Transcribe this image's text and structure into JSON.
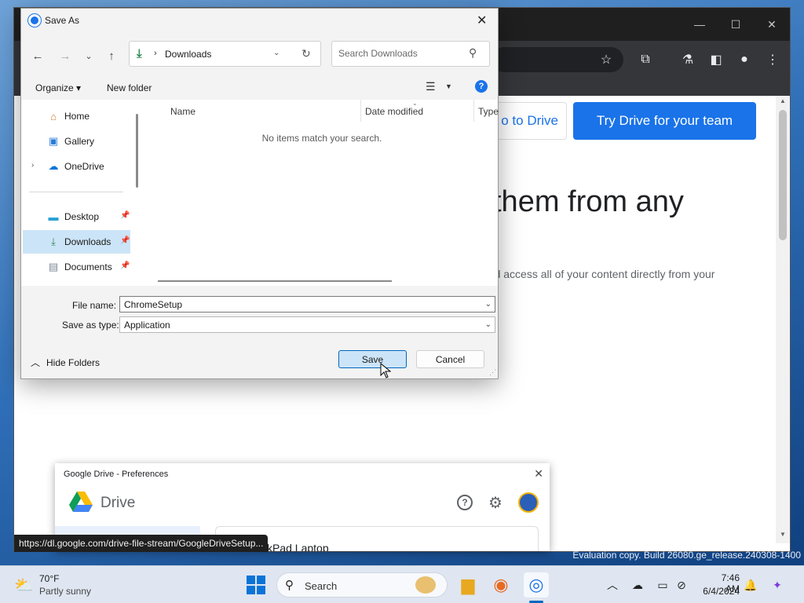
{
  "save_dialog": {
    "title": "Save As",
    "address": {
      "folder": "Downloads"
    },
    "search": {
      "placeholder": "Search Downloads"
    },
    "command_bar": {
      "organize_label": "Organize",
      "new_folder_label": "New folder"
    },
    "nav_items": [
      {
        "label": "Home",
        "icon": "home-icon"
      },
      {
        "label": "Gallery",
        "icon": "gallery-icon"
      },
      {
        "label": "OneDrive",
        "icon": "onedrive-icon"
      },
      {
        "label": "Desktop",
        "icon": "desktop-icon"
      },
      {
        "label": "Downloads",
        "icon": "downloads-icon",
        "selected": true
      },
      {
        "label": "Documents",
        "icon": "documents-icon"
      }
    ],
    "columns": [
      "Name",
      "Date modified",
      "Type"
    ],
    "empty_message": "No items match your search.",
    "file_name_label": "File name:",
    "file_name_value": "ChromeSetup",
    "save_as_type_label": "Save as type:",
    "save_as_type_value": "Application",
    "hide_folders_label": "Hide Folders",
    "save_label": "Save",
    "cancel_label": "Cancel"
  },
  "browser_page": {
    "goto_drive_label": "o to Drive",
    "try_drive_label": "Try Drive for your team",
    "hero_text": "them from any",
    "sub_text": "and access all of your content directly from your"
  },
  "drive_prefs": {
    "title": "Google Drive - Preferences",
    "app_name": "Drive",
    "card_text": "kPad Laptop"
  },
  "status_url": "https://dl.google.com/drive-file-stream/GoogleDriveSetup...",
  "watermark": "Evaluation copy. Build 26080.ge_release.240308-1400",
  "taskbar": {
    "weather_temp": "70°F",
    "weather_desc": "Partly sunny",
    "search_label": "Search",
    "time": "7:46 AM",
    "date": "6/4/2024"
  },
  "colors": {
    "accent": "#1a73e8",
    "win_accent": "#0067c0",
    "selection": "#cce4f7",
    "chrome_dark": "#35363a"
  }
}
